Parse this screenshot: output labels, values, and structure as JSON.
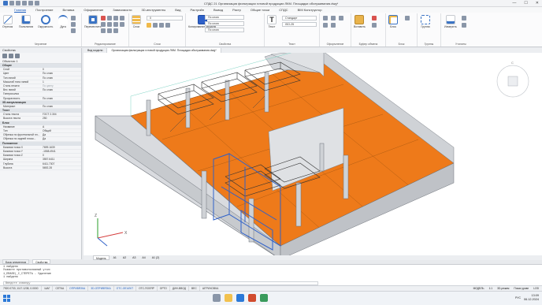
{
  "window": {
    "title": "СПДС 21 Организация фильтрации готовой продукции ЛКМ. Площадки обслуживания.dwg*",
    "controls": [
      "—",
      "☐",
      "✕"
    ]
  },
  "menu": {
    "items": [
      "Главная",
      "Построение",
      "Вставка",
      "Оформление",
      "Зависимости",
      "3D-инструменты",
      "Вид",
      "Растрийн",
      "Вывод",
      "Растр",
      "Общие точки",
      "СПДС",
      "BIM Конструктор"
    ],
    "active_index": 0
  },
  "ribbon": {
    "groups": [
      "Черчение",
      "Редактирование",
      "Слои",
      "Свойства",
      "Текст",
      "Оформление",
      "Буфер обмена",
      "Блок",
      "Группы",
      "Утилиты"
    ],
    "buttons": {
      "line": "Отрезок",
      "polyline": "Полилиния",
      "circle": "Окружность",
      "arc": "Дуга",
      "move": "Переместить",
      "copy": "Копировать",
      "layers": "Слои",
      "match": "Копирование свойств",
      "text": "Текст",
      "paste": "Вставить",
      "block": "Блок",
      "group": "Группа",
      "measure": "Измерить"
    },
    "combos": {
      "layer_color": "По слою",
      "layer_linetype": "По слою",
      "layer_lineweight": "По слою",
      "text_style": "Стандарт",
      "dim_style": "ISO-25"
    }
  },
  "properties_panel": {
    "title": "Свойства",
    "object": "Объектов: 1",
    "sections": [
      {
        "name": "Общие",
        "rows": [
          {
            "k": "Слой",
            "v": "0"
          },
          {
            "k": "Цвет",
            "v": "По слою"
          },
          {
            "k": "Тип линий",
            "v": "По слою"
          },
          {
            "k": "Масштаб типа линий",
            "v": "1"
          },
          {
            "k": "Стиль печати",
            "v": "По цвету",
            "dim": true
          },
          {
            "k": "Вес линий",
            "v": "По слою"
          },
          {
            "k": "Гиперссылка",
            "v": ""
          },
          {
            "k": "Прозрачность",
            "v": "По слою"
          }
        ]
      },
      {
        "name": "3D-визуализация",
        "rows": [
          {
            "k": "Материал",
            "v": "По слою"
          }
        ]
      },
      {
        "name": "Текст",
        "rows": [
          {
            "k": "Стиль текста",
            "v": "ГОСТ 2.304"
          },
          {
            "k": "Высота текста",
            "v": "250"
          }
        ]
      },
      {
        "name": "Блок",
        "rows": [
          {
            "k": "Название",
            "v": "А"
          },
          {
            "k": "Тип",
            "v": "Общий"
          },
          {
            "k": "Обрезка по фронтальной пл...",
            "v": "Да"
          },
          {
            "k": "Обрезка по задней плоск...",
            "v": "Да"
          }
        ]
      },
      {
        "name": "Положение",
        "rows": [
          {
            "k": "Базовая точка X",
            "v": "7699.1639"
          },
          {
            "k": "Базовая точка Y",
            "v": "-1558.4941"
          },
          {
            "k": "Базовая точка Z",
            "v": "0"
          },
          {
            "k": "Ширина",
            "v": "3557.6411"
          },
          {
            "k": "Глубина",
            "v": "6411.7307"
          },
          {
            "k": "Высота",
            "v": "5692.28"
          }
        ]
      }
    ]
  },
  "command_tabs": [
    "База элементов",
    "Свойства"
  ],
  "doc_tabs": [
    "Вид модели",
    "Организация фильтрации готовой продукции ЛКМ. Площадки обслуживания.dwg*"
  ],
  "layout_tabs": [
    "Модель",
    "A1",
    "A2",
    "A3",
    "A4",
    "A1 (2)"
  ],
  "command_lines": [
    "1 найдено",
    "Укажите противоположный угол:",
    "1_ERASE(_С_СТЕРЕТЬ - Удаление",
    "1 найдено"
  ],
  "command_prompt": "Введите команду",
  "status": {
    "coords": "7920.0733, 1117.1238, 0.0000",
    "toggles": [
      {
        "label": "ШАГ",
        "on": false
      },
      {
        "label": "СЕТКА",
        "on": false
      },
      {
        "label": "ОПРИВЯЗКА",
        "on": true
      },
      {
        "label": "3D-ОПРИВЯЗКА",
        "on": true
      },
      {
        "label": "ОТС-ОБЪЕКТ",
        "on": true
      },
      {
        "label": "ОТС-ПОЛЯР",
        "on": false
      },
      {
        "label": "ОРТО",
        "on": false
      },
      {
        "label": "ДИН-ВВОД",
        "on": false
      },
      {
        "label": "ВЕС",
        "on": false
      },
      {
        "label": "ШТРИХОВКА",
        "on": false
      }
    ],
    "model": "МОДЕЛЬ",
    "scale": "1:1",
    "view_mode": "3D-режим",
    "sel": "Показ уровн",
    "lod": "LOD"
  },
  "taskbar": {
    "time": "13:09",
    "date": "06.12.2024",
    "lang": "РУС"
  },
  "colors": {
    "floor": "#ee7a1a",
    "walls": "#c9ccd1",
    "selection": "#2f61c9",
    "accent": "#1f5fbf"
  }
}
